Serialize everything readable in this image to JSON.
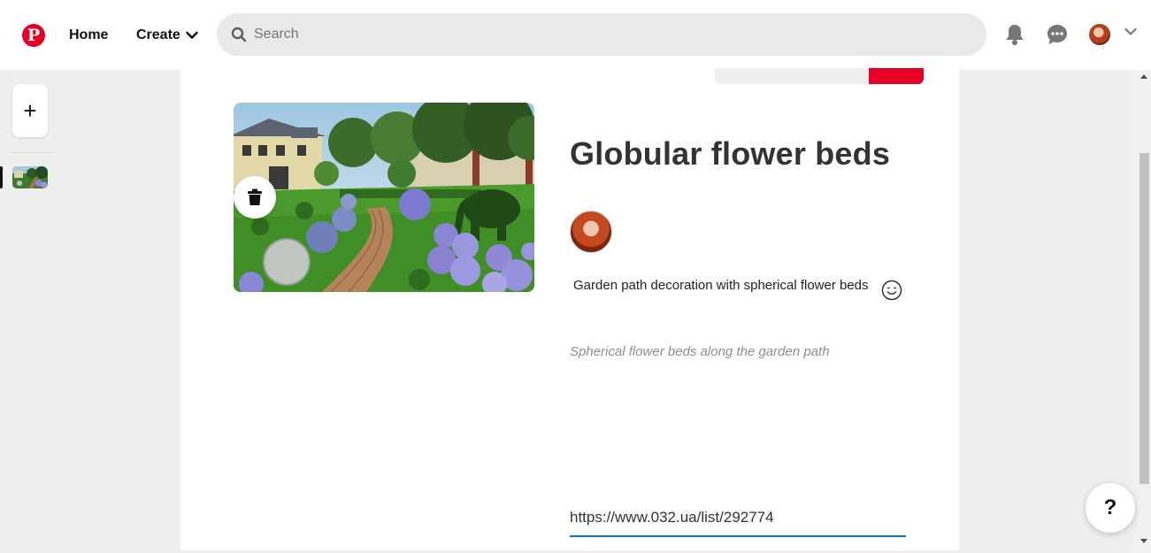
{
  "header": {
    "logo_glyph": "P",
    "home_label": "Home",
    "create_label": "Create",
    "search_placeholder": "Search",
    "brand_color": "#e60023",
    "icons": [
      "pinterest-logo",
      "chevron-down-icon",
      "search-icon",
      "bell-icon",
      "chat-icon",
      "avatar",
      "chevron-down-icon"
    ]
  },
  "sidebar": {
    "add_label": "+"
  },
  "pin": {
    "title": "Globular flower beds",
    "description": "Garden path decoration with spherical flower beds",
    "alt_text": "Spherical flower beds along the garden path",
    "link": "https://www.032.ua/list/292774",
    "link_underline_color": "#0074e8"
  },
  "help": {
    "label": "?"
  }
}
